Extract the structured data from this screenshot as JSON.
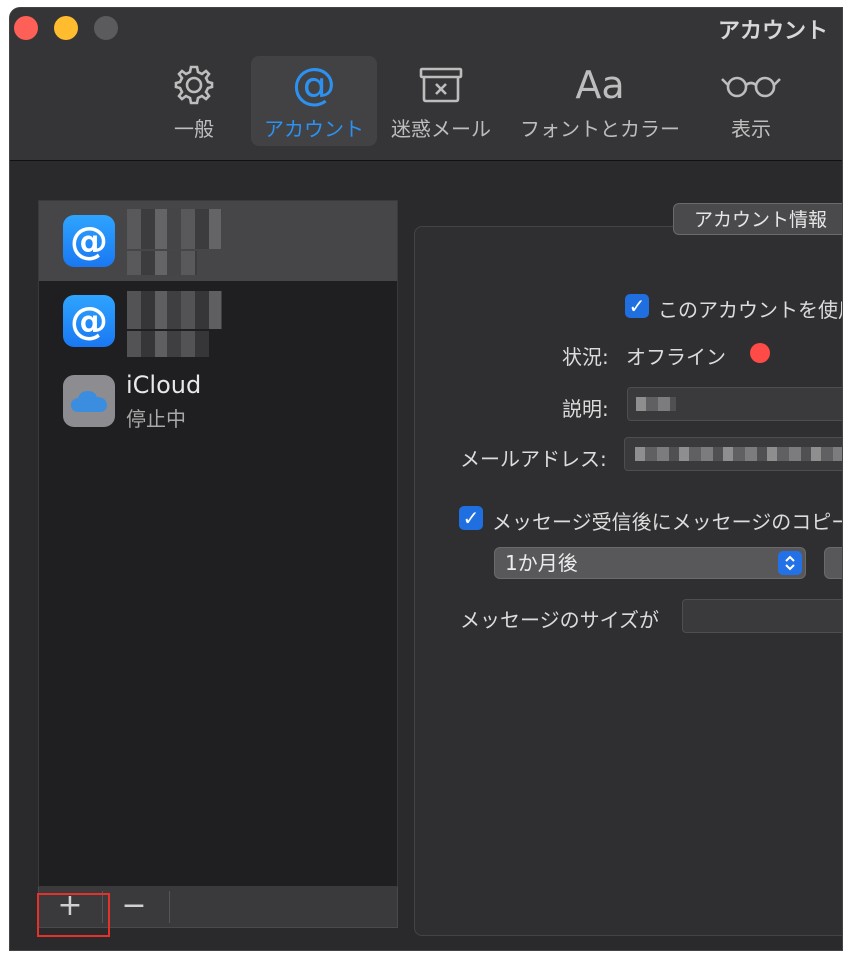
{
  "window": {
    "title": "アカウント"
  },
  "toolbar": {
    "items": [
      {
        "label": "一般",
        "icon": "gear-icon"
      },
      {
        "label": "アカウント",
        "icon": "at-sign-icon",
        "active": true
      },
      {
        "label": "迷惑メール",
        "icon": "junk-tray-icon"
      },
      {
        "label": "フォントとカラー",
        "icon": "font-aa-icon",
        "glyph": "Aa"
      },
      {
        "label": "表示",
        "icon": "glasses-icon"
      }
    ],
    "at_glyph": "@"
  },
  "accounts": [
    {
      "type": "mail",
      "glyph": "@",
      "selected": true
    },
    {
      "type": "mail",
      "glyph": "@",
      "selected": false
    },
    {
      "type": "icloud",
      "name": "iCloud",
      "status": "停止中",
      "selected": false
    }
  ],
  "list_controls": {
    "add": "+",
    "remove": "−"
  },
  "panel": {
    "tab_label": "アカウント情報",
    "enable_checkbox_label": "このアカウントを使用",
    "status_label": "状況:",
    "status_value": "オフライン",
    "description_label": "説明:",
    "email_label": "メールアドレス:",
    "remove_copy_checkbox_label": "メッセージ受信後にメッセージのコピーを削除",
    "remove_after_value": "1か月後",
    "message_size_label": "メッセージのサイズが"
  },
  "colors": {
    "accent": "#2b92f2",
    "checkbox": "#1f6fe0",
    "status_offline": "#fe4b48",
    "highlight": "#e2322a"
  }
}
